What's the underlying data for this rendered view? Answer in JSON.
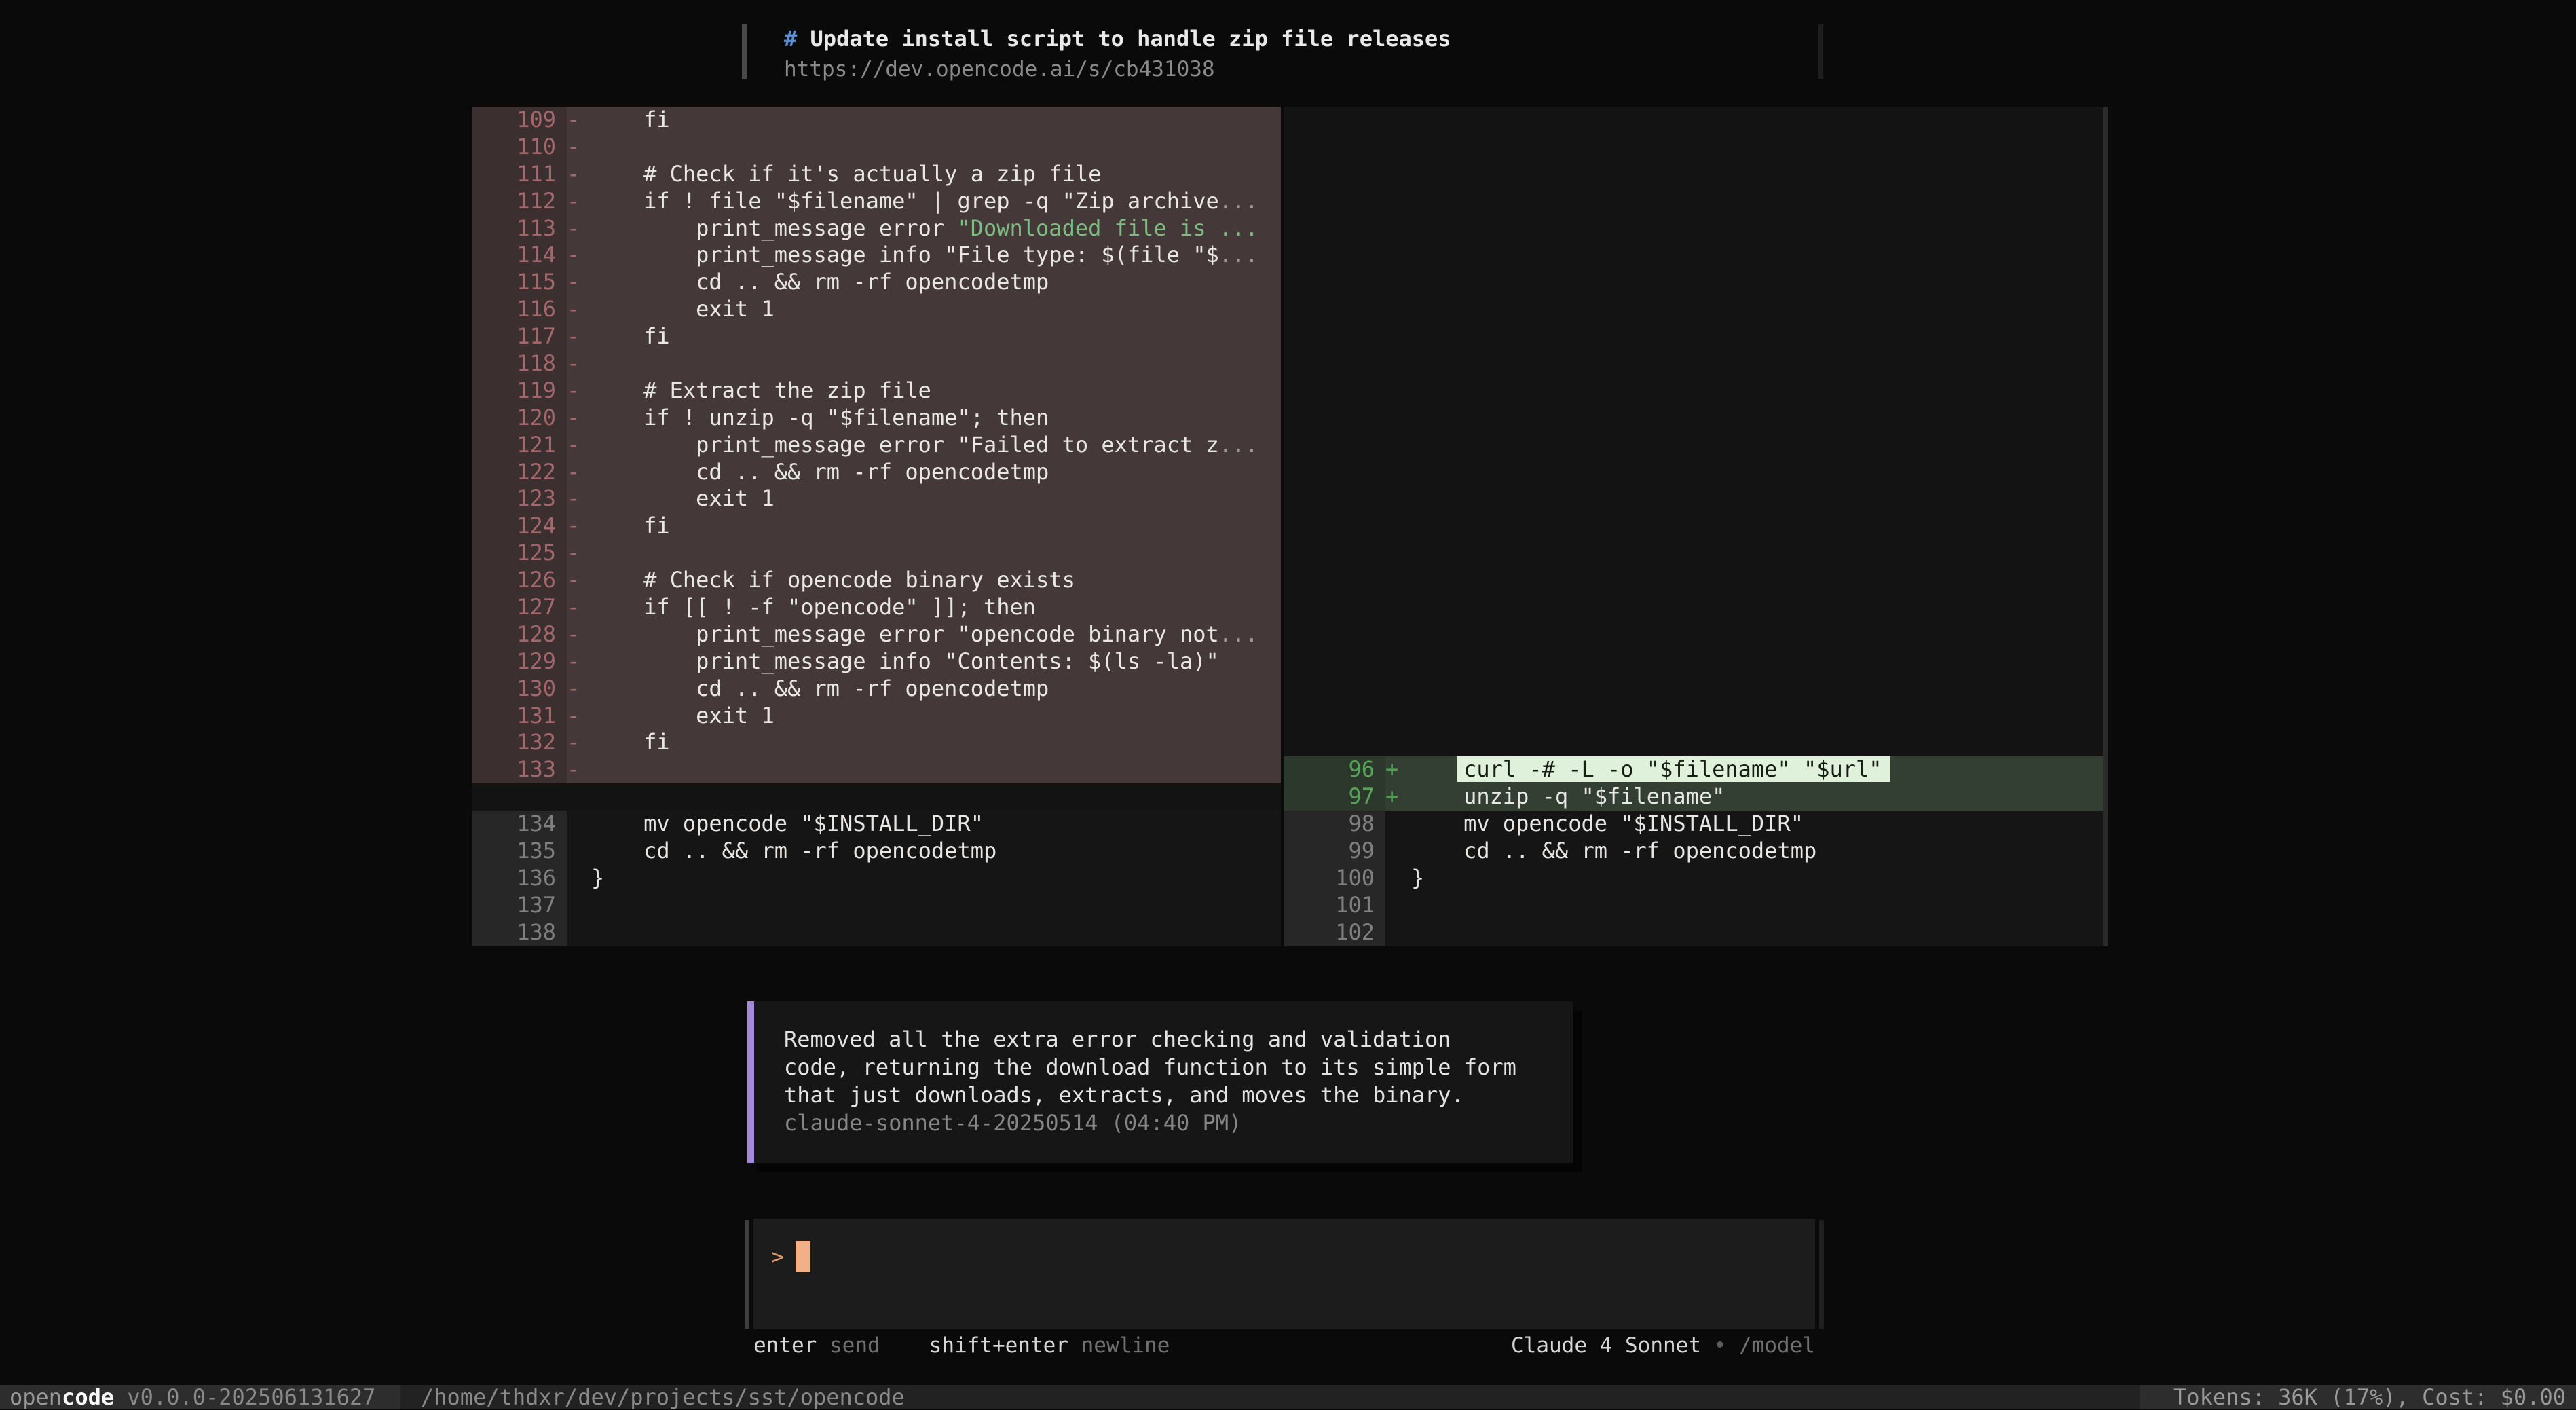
{
  "header": {
    "hash": "#",
    "title": " Update install script to handle zip file releases",
    "url": "https://dev.opencode.ai/s/cb431038"
  },
  "colors": {
    "accent_purple": "#a487e0",
    "removed_bg": "#453839",
    "added_bg": "#323f32",
    "highlight_bg": "#e0f1db",
    "string_green": "#7dbd82",
    "hash_blue": "#5a8fd6",
    "cursor_peach": "#f2b089"
  },
  "diff": {
    "left": {
      "rows": [
        {
          "n": "109",
          "m": "-",
          "t": "removed",
          "c": [
            {
              "s": "    fi"
            }
          ]
        },
        {
          "n": "110",
          "m": "-",
          "t": "removed",
          "c": [
            {
              "s": ""
            }
          ]
        },
        {
          "n": "111",
          "m": "-",
          "t": "removed",
          "c": [
            {
              "s": "    # Check if it's actually a zip file"
            }
          ]
        },
        {
          "n": "112",
          "m": "-",
          "t": "removed",
          "c": [
            {
              "s": "    if ! file \"$filename\" | grep -q \"Zip archive"
            },
            {
              "s": "...",
              "k": "dim"
            }
          ]
        },
        {
          "n": "113",
          "m": "-",
          "t": "removed",
          "c": [
            {
              "s": "        print_message error "
            },
            {
              "s": "\"Downloaded file is ...",
              "k": "green"
            }
          ]
        },
        {
          "n": "114",
          "m": "-",
          "t": "removed",
          "c": [
            {
              "s": "        print_message info \"File type: $(file \"$"
            },
            {
              "s": "...",
              "k": "dim"
            }
          ]
        },
        {
          "n": "115",
          "m": "-",
          "t": "removed",
          "c": [
            {
              "s": "        cd .. && rm -rf opencodetmp"
            }
          ]
        },
        {
          "n": "116",
          "m": "-",
          "t": "removed",
          "c": [
            {
              "s": "        exit 1"
            }
          ]
        },
        {
          "n": "117",
          "m": "-",
          "t": "removed",
          "c": [
            {
              "s": "    fi"
            }
          ]
        },
        {
          "n": "118",
          "m": "-",
          "t": "removed",
          "c": [
            {
              "s": ""
            }
          ]
        },
        {
          "n": "119",
          "m": "-",
          "t": "removed",
          "c": [
            {
              "s": "    # Extract the zip file"
            }
          ]
        },
        {
          "n": "120",
          "m": "-",
          "t": "removed",
          "c": [
            {
              "s": "    if ! unzip -q \"$filename\"; then"
            }
          ]
        },
        {
          "n": "121",
          "m": "-",
          "t": "removed",
          "c": [
            {
              "s": "        print_message error \"Failed to extract z"
            },
            {
              "s": "...",
              "k": "dim"
            }
          ]
        },
        {
          "n": "122",
          "m": "-",
          "t": "removed",
          "c": [
            {
              "s": "        cd .. && rm -rf opencodetmp"
            }
          ]
        },
        {
          "n": "123",
          "m": "-",
          "t": "removed",
          "c": [
            {
              "s": "        exit 1"
            }
          ]
        },
        {
          "n": "124",
          "m": "-",
          "t": "removed",
          "c": [
            {
              "s": "    fi"
            }
          ]
        },
        {
          "n": "125",
          "m": "-",
          "t": "removed",
          "c": [
            {
              "s": ""
            }
          ]
        },
        {
          "n": "126",
          "m": "-",
          "t": "removed",
          "c": [
            {
              "s": "    # Check if opencode binary exists"
            }
          ]
        },
        {
          "n": "127",
          "m": "-",
          "t": "removed",
          "c": [
            {
              "s": "    if [[ ! -f \"opencode\" ]]; then"
            }
          ]
        },
        {
          "n": "128",
          "m": "-",
          "t": "removed",
          "c": [
            {
              "s": "        print_message error \"opencode binary not"
            },
            {
              "s": "...",
              "k": "dim"
            }
          ]
        },
        {
          "n": "129",
          "m": "-",
          "t": "removed",
          "c": [
            {
              "s": "        print_message info \"Contents: $(ls -la)\""
            }
          ]
        },
        {
          "n": "130",
          "m": "-",
          "t": "removed",
          "c": [
            {
              "s": "        cd .. && rm -rf opencodetmp"
            }
          ]
        },
        {
          "n": "131",
          "m": "-",
          "t": "removed",
          "c": [
            {
              "s": "        exit 1"
            }
          ]
        },
        {
          "n": "132",
          "m": "-",
          "t": "removed",
          "c": [
            {
              "s": "    fi"
            }
          ]
        },
        {
          "n": "133",
          "m": "-",
          "t": "removed",
          "c": [
            {
              "s": ""
            }
          ]
        },
        {
          "t": "filler"
        },
        {
          "n": "134",
          "m": "",
          "t": "context",
          "c": [
            {
              "s": "    mv opencode \"$INSTALL_DIR\""
            }
          ]
        },
        {
          "n": "135",
          "m": "",
          "t": "context",
          "c": [
            {
              "s": "    cd .. && rm -rf opencodetmp"
            }
          ]
        },
        {
          "n": "136",
          "m": "",
          "t": "context",
          "c": [
            {
              "s": "}"
            }
          ]
        },
        {
          "n": "137",
          "m": "",
          "t": "context",
          "c": [
            {
              "s": ""
            }
          ]
        },
        {
          "n": "138",
          "m": "",
          "t": "context",
          "c": [
            {
              "s": ""
            }
          ]
        }
      ]
    },
    "right": {
      "fillers_before": 24,
      "rows": [
        {
          "n": "96",
          "m": "+",
          "t": "added",
          "c": [
            {
              "s": "    "
            },
            {
              "s": "curl -# -L -o \"$filename\" \"$url\"",
              "k": "hl"
            }
          ]
        },
        {
          "n": "97",
          "m": "+",
          "t": "added",
          "c": [
            {
              "s": "    unzip -q \"$filename\""
            }
          ]
        },
        {
          "n": "98",
          "m": "",
          "t": "context",
          "c": [
            {
              "s": "    mv opencode \"$INSTALL_DIR\""
            }
          ]
        },
        {
          "n": "99",
          "m": "",
          "t": "context",
          "c": [
            {
              "s": "    cd .. && rm -rf opencodetmp"
            }
          ]
        },
        {
          "n": "100",
          "m": "",
          "t": "context",
          "c": [
            {
              "s": "}"
            }
          ]
        },
        {
          "n": "101",
          "m": "",
          "t": "context",
          "c": [
            {
              "s": ""
            }
          ]
        },
        {
          "n": "102",
          "m": "",
          "t": "context",
          "c": [
            {
              "s": ""
            }
          ]
        }
      ]
    }
  },
  "message": {
    "lines": [
      "Removed all the extra error checking and validation",
      "code, returning the download function to its simple form",
      "that just downloads, extracts, and moves the binary."
    ],
    "meta": "claude-sonnet-4-20250514 (04:40 PM)"
  },
  "input": {
    "prompt": ">",
    "value": ""
  },
  "hints": [
    {
      "key": "enter",
      "label": "send"
    },
    {
      "key": "shift+enter",
      "label": "newline"
    }
  ],
  "model": {
    "name": "Claude 4 Sonnet",
    "separator": "•",
    "command": "/model"
  },
  "statusbar": {
    "app_dim": "open",
    "app_bold": "code",
    "version": " v0.0.0-202506131627",
    "path": "/home/thdxr/dev/projects/sst/opencode",
    "stats": "Tokens: 36K (17%), Cost: $0.00"
  }
}
